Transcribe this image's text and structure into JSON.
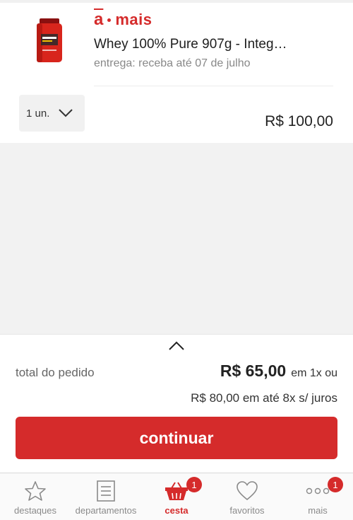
{
  "product": {
    "brand_prefix": "a",
    "brand_name": "mais",
    "title": "Whey 100% Pure 907g - Integ…",
    "delivery": "entrega: receba até 07 de julho",
    "quantity": "1 un.",
    "price": "R$ 100,00"
  },
  "summary": {
    "total_label": "total do pedido",
    "total_value": "R$ 65,00",
    "total_condition": "em 1x ou",
    "installments": "R$ 80,00 em até 8x s/ juros",
    "continue_label": "continuar"
  },
  "tabbar": {
    "items": [
      {
        "label": "destaques",
        "icon": "star-icon"
      },
      {
        "label": "departamentos",
        "icon": "list-icon"
      },
      {
        "label": "cesta",
        "icon": "basket-icon",
        "badge": "1"
      },
      {
        "label": "favoritos",
        "icon": "heart-icon"
      },
      {
        "label": "mais",
        "icon": "more-dots-icon",
        "badge": "1"
      }
    ]
  },
  "colors": {
    "accent": "#d52b2b",
    "background_gray": "#f2f2f2"
  }
}
